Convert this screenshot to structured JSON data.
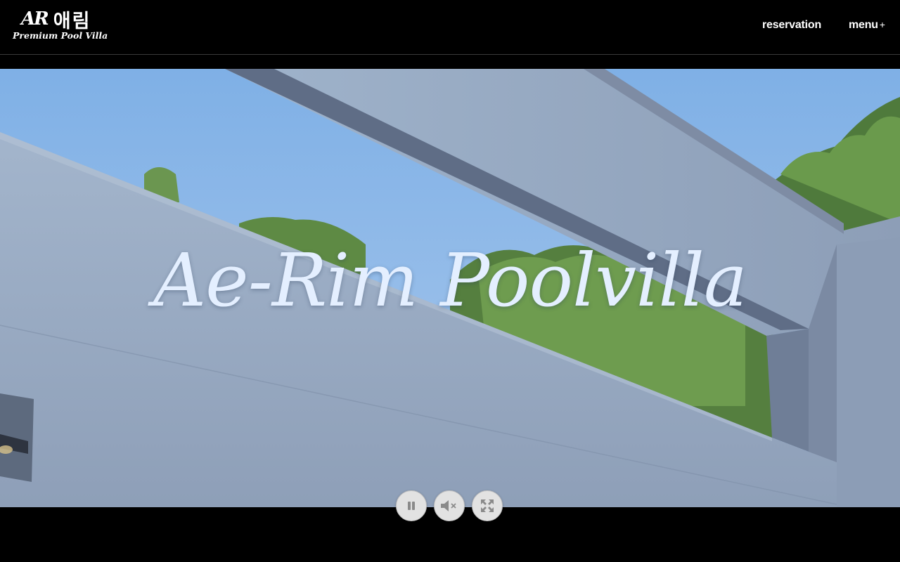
{
  "header": {
    "logo": {
      "mark": "AR",
      "korean": "애림",
      "tagline": "Premium Pool Villa"
    },
    "nav": {
      "reservation": "reservation",
      "menu": "menu",
      "menu_plus": "+"
    }
  },
  "hero": {
    "title": "Ae-Rim Poolvilla"
  },
  "video_controls": [
    {
      "name": "pause",
      "icon": "pause-icon"
    },
    {
      "name": "mute",
      "icon": "muted-speaker-icon"
    },
    {
      "name": "fullscreen",
      "icon": "fullscreen-icon"
    }
  ],
  "colors": {
    "header_bg": "#000000",
    "title_color": "#e4efff",
    "sky": "#8fb6de",
    "wall": "#9eb0c8"
  }
}
